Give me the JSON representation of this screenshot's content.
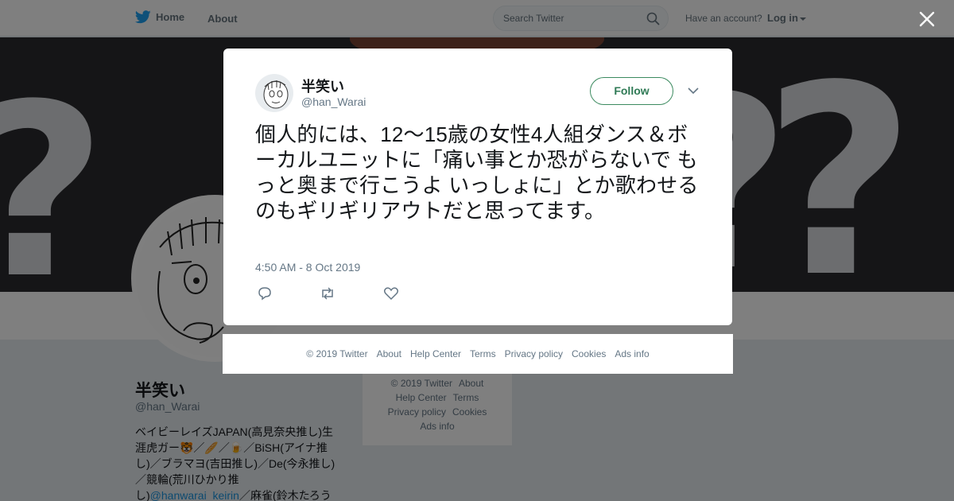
{
  "nav": {
    "home_label": "Home",
    "about_label": "About",
    "search_placeholder": "Search Twitter",
    "account_question": "Have an account?",
    "login_label": "Log in"
  },
  "profile": {
    "name": "半笑い",
    "handle": "@han_Warai",
    "bio_text": "ベイビーレイズJAPAN(高見奈央推し)生涯虎ガー🐯／🥖／🍺／BiSH(アイナ推し)／ブラマヨ(吉田推し)／De(今永推し)／競輪(荒川ひかり推し)",
    "bio_link": "@hanwarai_keirin",
    "bio_tail": "／麻雀(鈴木たろう"
  },
  "side_footer": {
    "copyright": "© 2019 Twitter",
    "about": "About",
    "help": "Help Center",
    "terms": "Terms",
    "privacy": "Privacy policy",
    "cookies": "Cookies",
    "ads": "Ads info"
  },
  "tweet": {
    "author_name": "半笑い",
    "author_handle": "@han_Warai",
    "follow_label": "Follow",
    "text": "個人的には、12〜15歳の女性4人組ダンス＆ボーカルユニットに「痛い事とか恐がらないで もっと奥まで行こうよ いっしょに」とか歌わせるのもギリギリアウトだと思ってます。",
    "timestamp": "4:50 AM - 8 Oct 2019"
  },
  "footer": {
    "copyright": "© 2019 Twitter",
    "about": "About",
    "help": "Help Center",
    "terms": "Terms",
    "privacy": "Privacy policy",
    "cookies": "Cookies",
    "ads": "Ads info"
  },
  "colors": {
    "twitter_blue": "#1da1f2",
    "follow_green": "#2f7a55",
    "overlay": "rgba(0,0,0,0.5)"
  },
  "icons": [
    "twitter-bird-icon",
    "search-icon",
    "close-icon",
    "chevron-down-icon",
    "reply-icon",
    "retweet-icon",
    "like-icon"
  ]
}
